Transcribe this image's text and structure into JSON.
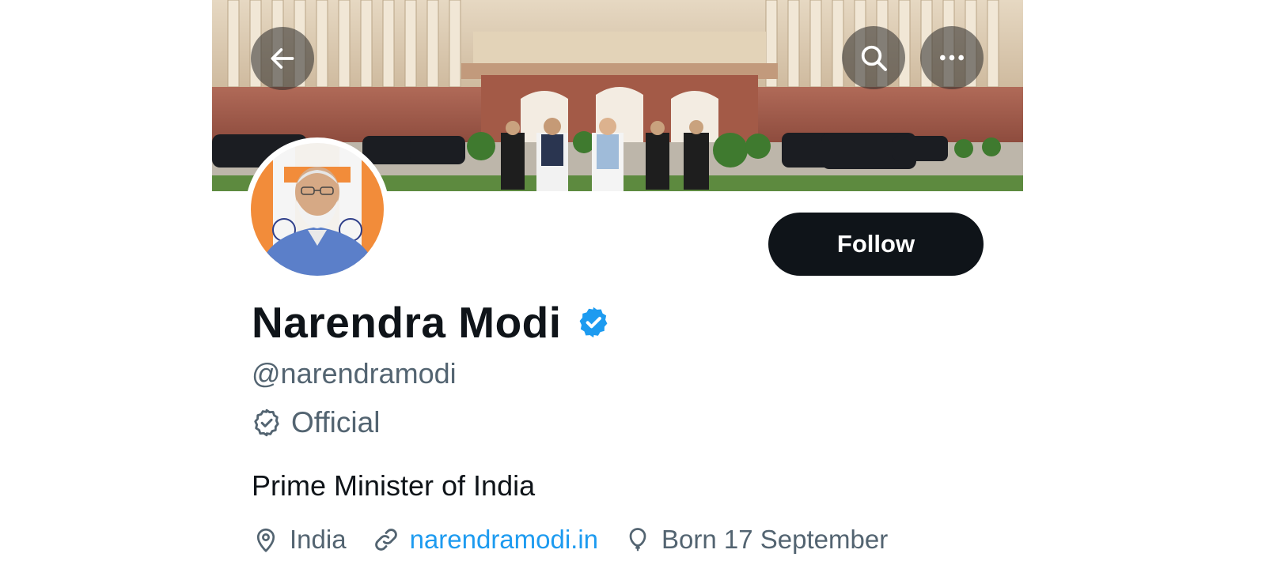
{
  "header": {
    "back_icon": "arrow-left-icon",
    "search_icon": "search-icon",
    "more_icon": "more-horizontal-icon"
  },
  "banner": {
    "description_icon": "banner-image"
  },
  "profile": {
    "display_name": "Narendra Modi",
    "handle": "@narendramodi",
    "verified_icon": "verified-badge-icon",
    "official_label": "Official",
    "bio": "Prime Minister of India",
    "location": "India",
    "website": "narendramodi.in",
    "birthday": "Born 17 September"
  },
  "actions": {
    "follow_label": "Follow"
  },
  "colors": {
    "text_primary": "#0f1419",
    "text_secondary": "#536471",
    "link": "#1d9bf0",
    "verified": "#1d9bf0",
    "follow_bg": "#0f1419"
  }
}
